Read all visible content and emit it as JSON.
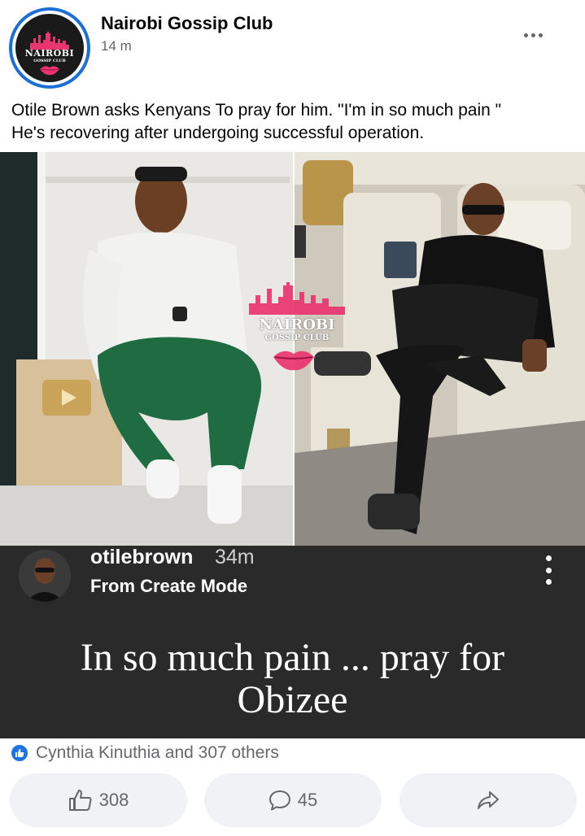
{
  "post": {
    "page_name": "Nairobi Gossip Club",
    "time": "14 m",
    "caption_line1": "Otile Brown asks Kenyans To pray for him. \"I'm in so much pain \"",
    "caption_line2": "He's recovering after undergoing successful operation.",
    "logo": {
      "line1": "NAIROBI",
      "line2": "GOSSIP CLUB"
    }
  },
  "photo": {
    "watermark_line1": "NAIROBI",
    "watermark_line2": "GOSSIP CLUB"
  },
  "story": {
    "username": "otilebrown",
    "time": "34m",
    "mode": "From Create Mode",
    "text_line1": "In so much pain ... pray for",
    "text_line2": "Obizee"
  },
  "reactions": {
    "summary": "Cynthia Kinuthia and 307 others"
  },
  "actions": {
    "like_count": "308",
    "comment_count": "45"
  },
  "colors": {
    "accent": "#1b74e4",
    "muted_text": "#65676b",
    "button_bg": "#f0f2f5",
    "story_bg": "#2a2a2a"
  },
  "icons": [
    "more-options-icon",
    "like-icon",
    "comment-icon",
    "share-icon",
    "like-reaction-icon"
  ]
}
